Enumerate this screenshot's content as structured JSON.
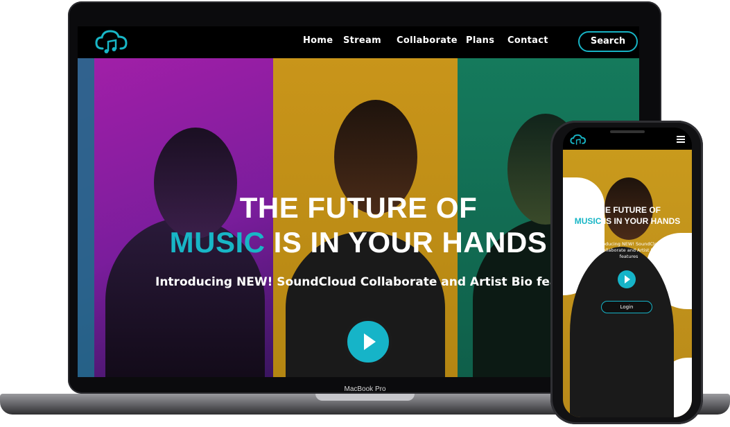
{
  "desktop": {
    "nav": {
      "links": [
        "Home",
        "Stream",
        "Collaborate",
        "Plans",
        "Contact"
      ],
      "search_label": "Search"
    },
    "hero": {
      "headline_line1": "THE FUTURE OF",
      "headline_accent": "MUSIC",
      "headline_line2_rest": " IS IN YOUR HANDS",
      "subheadline": "Introducing NEW! SoundCloud Collaborate and Artist Bio features"
    }
  },
  "device": {
    "laptop_label": "MacBook Pro"
  },
  "mobile": {
    "hero": {
      "headline_line1": "THE FUTURE OF",
      "headline_accent": "MUSIC",
      "headline_line2_rest": " IS IN YOUR HANDS",
      "subheadline": "Introducing NEW! SoundCloud Collaborate and Artist Bio features"
    },
    "login_label": "Login"
  },
  "colors": {
    "accent": "#18b6c6",
    "nav_bg": "#000000",
    "panel_purple": "#a21fa8",
    "panel_yellow": "#c9951a",
    "panel_green": "#157a5c"
  },
  "icons": [
    "cloud-music-logo-icon",
    "play-icon",
    "hamburger-menu-icon"
  ]
}
